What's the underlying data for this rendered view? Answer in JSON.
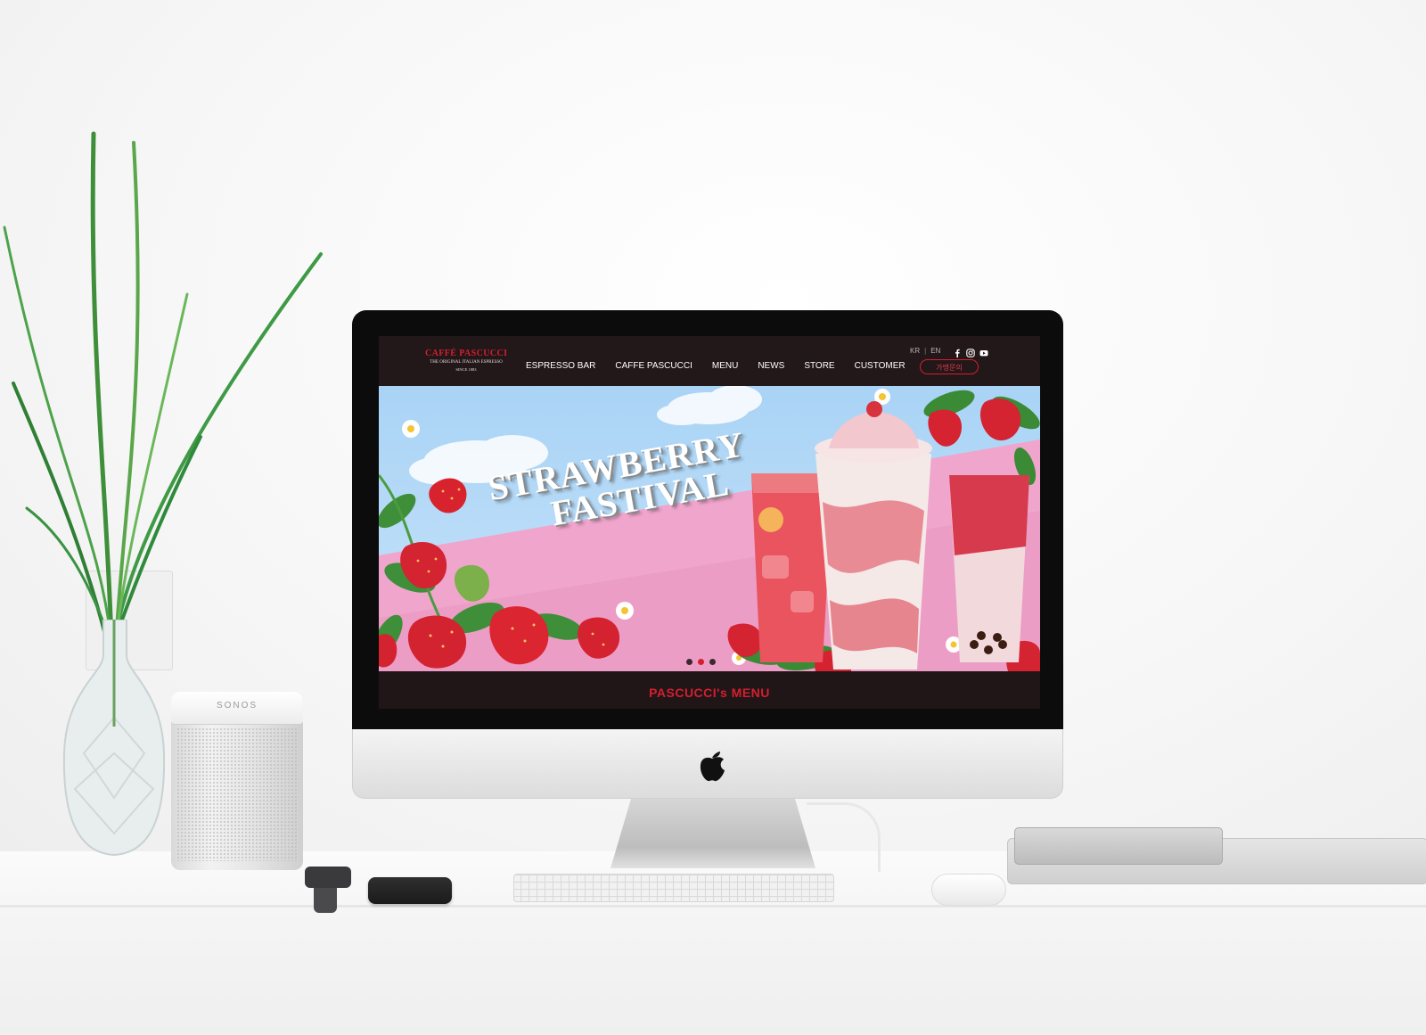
{
  "speaker": {
    "brand": "SONOS"
  },
  "site": {
    "logo": {
      "name": "CAFFÉ PASCUCCI",
      "tagline": "THE ORIGINAL ITALIAN ESPRESSO",
      "since": "SINCE 1883"
    },
    "nav": [
      {
        "label": "ESPRESSO BAR"
      },
      {
        "label": "CAFFE PASCUCCI"
      },
      {
        "label": "MENU"
      },
      {
        "label": "NEWS"
      },
      {
        "label": "STORE"
      },
      {
        "label": "CUSTOMER"
      }
    ],
    "lang": {
      "kr": "KR",
      "separator": "|",
      "en": "EN"
    },
    "social": [
      "facebook-icon",
      "instagram-icon",
      "youtube-icon"
    ],
    "franchise_button": "가맹문의",
    "hero": {
      "line1": "STRAWBERRY",
      "line2": "FASTIVAL",
      "slides": 3,
      "active_slide": 2
    },
    "section_heading": "PASCUCCI's MENU"
  },
  "colors": {
    "brand_red": "#d2202f",
    "header_bg": "#221719",
    "sky": "#a9d3f5",
    "pink": "#f0a5cc"
  }
}
